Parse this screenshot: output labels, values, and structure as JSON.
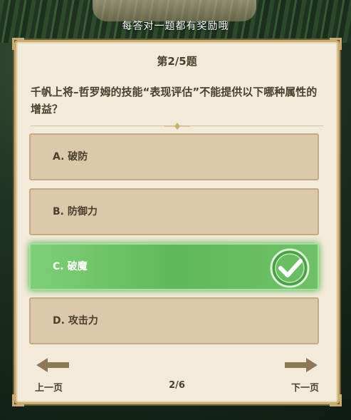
{
  "banner": {
    "text": "每答对一题都有奖励哦"
  },
  "quiz": {
    "progress": "第2/5题",
    "question": "千帆上将–哲罗姆的技能“表现评估”不能提供以下哪种属性的增益？",
    "options": [
      {
        "label": "A. 破防",
        "selected": false
      },
      {
        "label": "B. 防御力",
        "selected": false
      },
      {
        "label": "C. 破魔",
        "selected": true
      },
      {
        "label": "D. 攻击力",
        "selected": false
      }
    ]
  },
  "footer": {
    "prev_label": "上一页",
    "page": "2/6",
    "next_label": "下一页"
  },
  "colors": {
    "card_bg": "#f3ebda",
    "option_bg": "#dcc8aa",
    "selected_bg": "#5fb95a",
    "text": "#4b3f2e"
  },
  "icons": [
    "check-icon",
    "left-arrow-icon",
    "right-arrow-icon"
  ]
}
